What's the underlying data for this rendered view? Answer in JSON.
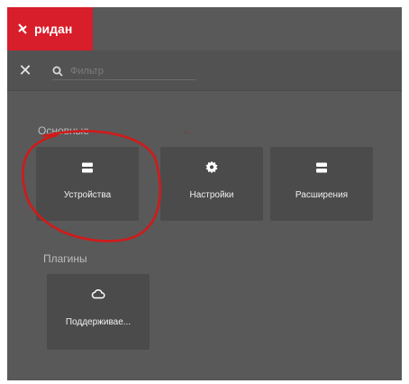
{
  "brand": {
    "name": "ридан",
    "icon": "logo-icon"
  },
  "toolbar": {
    "close_icon": "close-icon",
    "search": {
      "icon": "search-icon",
      "placeholder": "Фильтр",
      "value": ""
    }
  },
  "sections": {
    "main": {
      "title": "Основные",
      "tiles": [
        {
          "label": "Устройства",
          "icon": "devices-icon"
        },
        {
          "label": "Настройки",
          "icon": "gear-icon"
        },
        {
          "label": "Расширения",
          "icon": "extensions-icon"
        }
      ]
    },
    "plugins": {
      "title": "Плагины",
      "tiles": [
        {
          "label": "Поддерживае...",
          "icon": "cloud-icon"
        }
      ]
    }
  },
  "colors": {
    "brand": "#d81e2a",
    "background": "#595959",
    "tile": "#4b4b4b",
    "annotation": "#d11a1a"
  }
}
